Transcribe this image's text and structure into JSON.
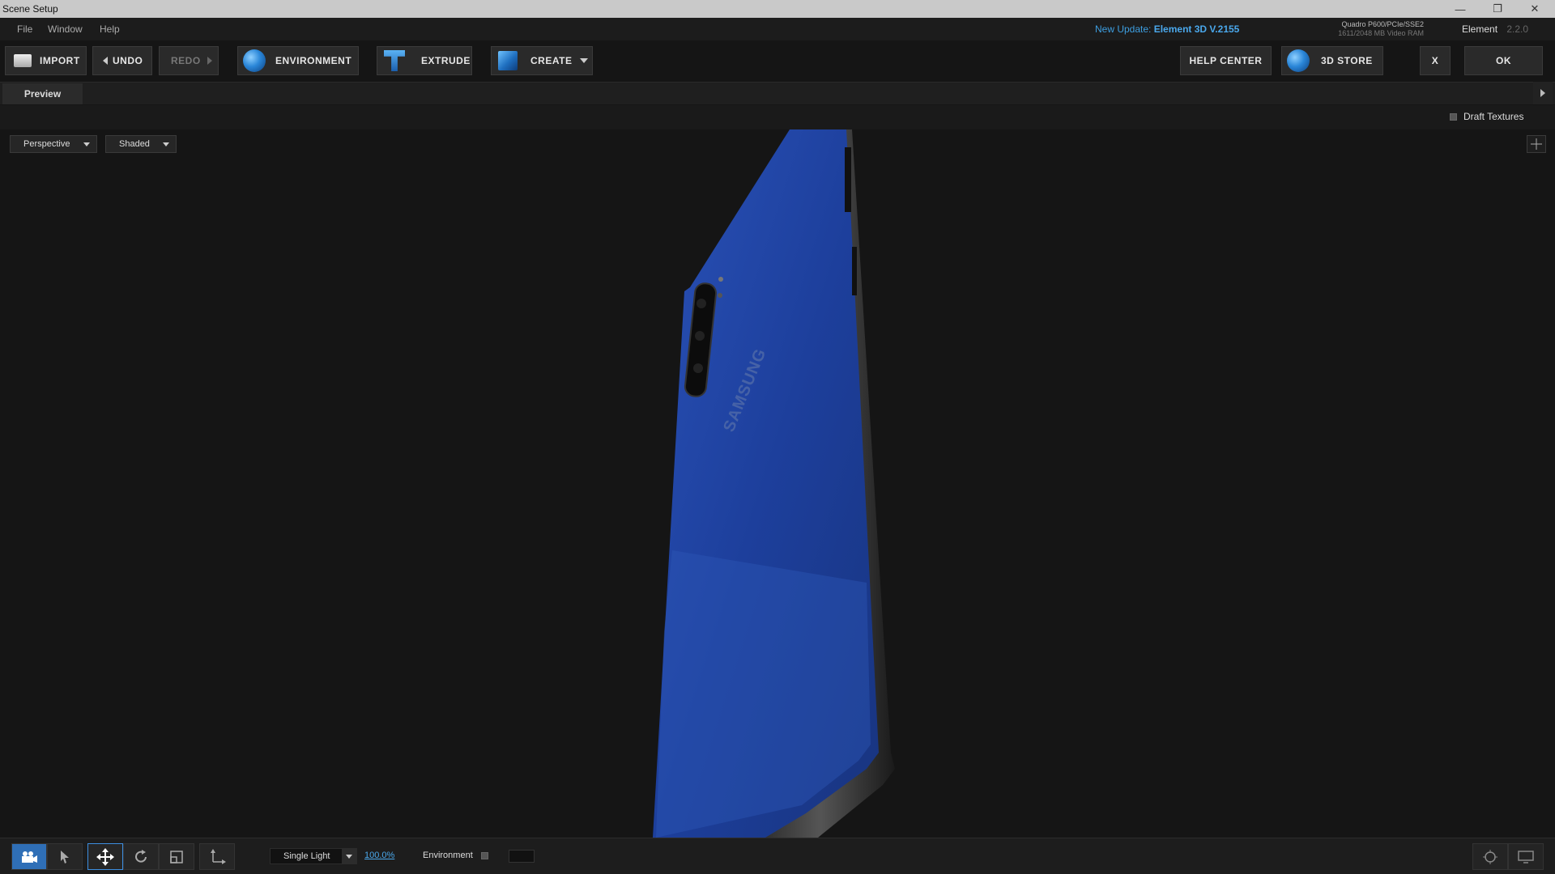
{
  "window": {
    "title": "Scene Setup",
    "controls": {
      "minimize": "—",
      "restore": "❐",
      "close": "✕"
    }
  },
  "menu": {
    "items": [
      "File",
      "Window",
      "Help"
    ]
  },
  "update_notice": {
    "prefix": "New Update:",
    "product": "Element 3D V.2155"
  },
  "gpu_info": {
    "line1": "Quadro P600/PCIe/SSE2",
    "line2": "1611/2048 MB Video RAM"
  },
  "product": {
    "name": "Element",
    "version": "2.2.0"
  },
  "toolbar": {
    "import": "IMPORT",
    "undo": "UNDO",
    "redo": "REDO",
    "environment": "ENVIRONMENT",
    "extrude": "EXTRUDE",
    "create": "CREATE",
    "help_center": "HELP CENTER",
    "store": "3D STORE",
    "close": "X",
    "ok": "OK"
  },
  "tabs": {
    "preview": "Preview"
  },
  "options": {
    "draft_textures": "Draft Textures",
    "draft_textures_checked": false
  },
  "viewport": {
    "camera_view": "Perspective",
    "shading_mode": "Shaded",
    "model_brand_text": "SAMSUNG"
  },
  "bottom": {
    "camera_tools": [
      "camera-icon",
      "pointer-icon",
      "move-icon",
      "rotate-icon",
      "scale-icon",
      "axis-icon"
    ],
    "active_tool": "camera-icon",
    "lighting": "Single Light",
    "lighting_percent": "100.0%",
    "environment_label": "Environment",
    "environment_checked": false
  },
  "colors": {
    "accent": "#3d9ee0",
    "active_tool": "#2f6fb7",
    "phone_body": "#1e3f9a"
  }
}
